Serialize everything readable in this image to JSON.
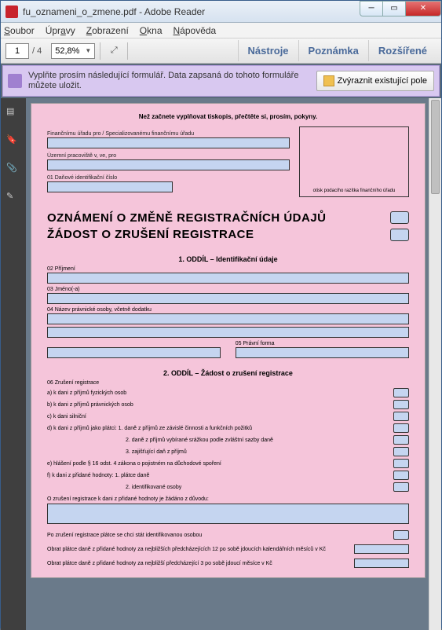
{
  "window": {
    "title": "fu_oznameni_o_zmene.pdf - Adobe Reader"
  },
  "menu": {
    "soubor": "Soubor",
    "upravy": "Úpravy",
    "zobrazeni": "Zobrazení",
    "okna": "Okna",
    "napoveda": "Nápověda"
  },
  "toolbar": {
    "page": "1",
    "total": "/ 4",
    "zoom": "52,8%"
  },
  "right_tools": {
    "nastroje": "Nástroje",
    "poznamka": "Poznámka",
    "rozsirene": "Rozšířené"
  },
  "banner": {
    "text": "Vyplňte prosím následující formulář. Data zapsaná do tohoto formuláře můžete uložit.",
    "highlight": "Zvýraznit existující pole"
  },
  "form": {
    "instr": "Než začnete vyplňovat tiskopis, přečtěte si, prosím, pokyny.",
    "stamp": "otisk podacího razítka finančního úřadu",
    "lbl_fu": "Finančnímu úřadu pro / Specializovanému finančnímu úřadu",
    "lbl_up": "Územní pracoviště v, ve, pro",
    "lbl_dic": "01 Daňové identifikační číslo",
    "title1": "OZNÁMENÍ O ZMĚNĚ REGISTRAČNÍCH ÚDAJŮ",
    "title2": "ŽÁDOST O ZRUŠENÍ REGISTRACE",
    "sec1": "1. ODDÍL – Identifikační údaje",
    "lbl_02": "02 Příjmení",
    "lbl_03": "03 Jméno(-a)",
    "lbl_04": "04 Název právnické osoby, včetně dodatku",
    "lbl_05": "05 Právní forma",
    "sec2": "2. ODDÍL – Žádost o zrušení registrace",
    "lbl_06": "06 Zrušení registrace",
    "a": "a)  k dani z příjmů fyzických osob",
    "b": "b)  k dani z příjmů právnických osob",
    "c": "c)  k dani silniční",
    "d": "d)  k dani z příjmů jako plátci: 1. daně z příjmů ze závislé činnosti a funkčních požitků",
    "d2": "2. daně z příjmů vybírané srážkou podle zvláštní sazby daně",
    "d3": "3. zajišťující daň z příjmů",
    "e": "e)  hlášení podle § 16 odst. 4 zákona o pojistném na důchodové spoření",
    "f": "f)  k dani z přidané hodnoty:  1. plátce daně",
    "f2": "2. identifikované osoby",
    "reason_lbl": "O zrušení registrace k dani z přidané hodnoty je žádáno z důvodu:",
    "after": "Po zrušení registrace plátce se chci stát identifikovanou osobou",
    "turnover12": "Obrat plátce daně z přidané hodnoty za nejbližších předcházejících 12 po sobě jdoucích kalendářních měsíců v Kč",
    "turnover3": "Obrat plátce daně z přidané hodnoty za nejbližší předcházející 3 po sobě jdoucí měsíce v Kč"
  }
}
